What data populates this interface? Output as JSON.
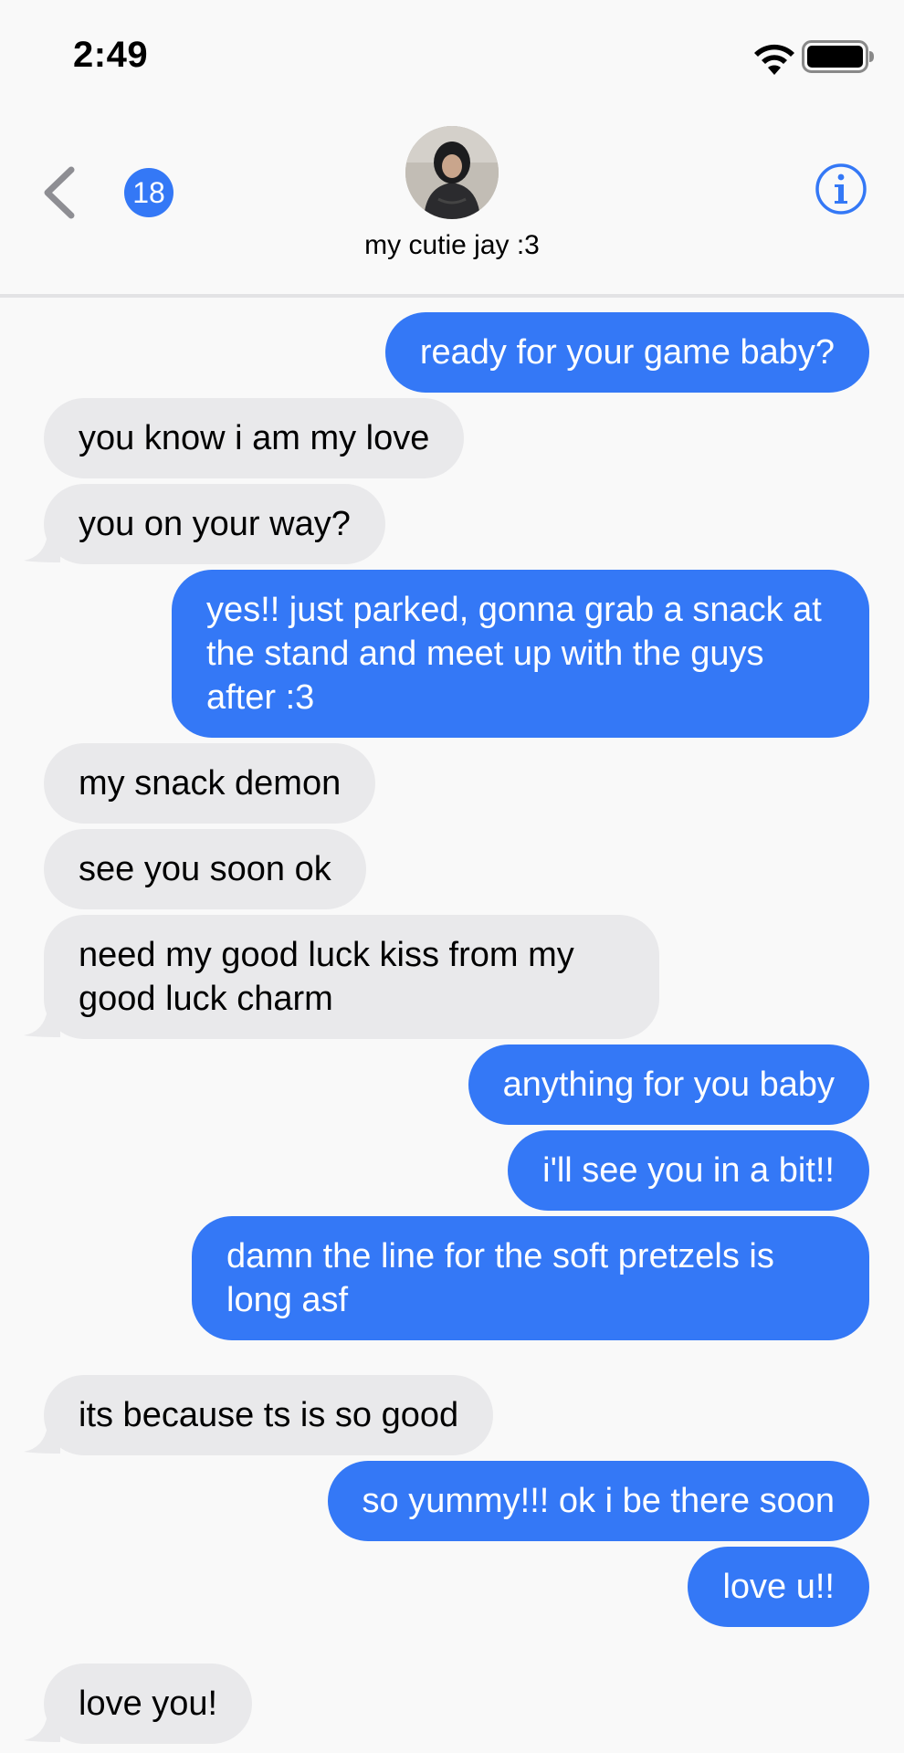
{
  "status_bar": {
    "time": "2:49",
    "wifi_icon": "wifi-icon",
    "battery_icon": "battery-icon"
  },
  "header": {
    "back_icon": "chevron-left-icon",
    "unread_count": "18",
    "contact_name": "my cutie jay :3",
    "info_icon": "info-icon"
  },
  "colors": {
    "sent_bubble": "#3478f6",
    "received_bubble": "#e9e9eb",
    "background": "#f9f9f9"
  },
  "messages": [
    {
      "direction": "sent",
      "text": "ready for your game baby?"
    },
    {
      "direction": "received",
      "text": "you know i am my love"
    },
    {
      "direction": "received",
      "text": "you on your way?"
    },
    {
      "direction": "sent",
      "text": "yes!! just parked, gonna grab a snack at the stand and meet up with the guys after :3"
    },
    {
      "direction": "received",
      "text": "my snack demon"
    },
    {
      "direction": "received",
      "text": "see you soon ok"
    },
    {
      "direction": "received",
      "text": "need my good luck kiss from my good luck charm"
    },
    {
      "direction": "sent",
      "text": "anything for you baby"
    },
    {
      "direction": "sent",
      "text": "i'll see you in a bit!!"
    },
    {
      "direction": "sent",
      "text": "damn the line for the soft pretzels is long asf"
    },
    {
      "direction": "received",
      "text": "its because ts is so good"
    },
    {
      "direction": "sent",
      "text": "so yummy!!! ok i be there soon"
    },
    {
      "direction": "sent",
      "text": "love u!!"
    },
    {
      "direction": "received",
      "text": "love you!"
    }
  ]
}
